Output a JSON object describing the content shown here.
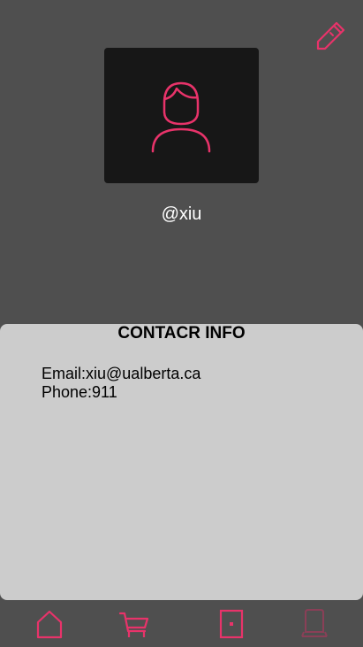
{
  "profile": {
    "username": "@xiu",
    "edit_icon": "pencil-icon",
    "avatar_icon": "user-icon"
  },
  "contact": {
    "title": "CONTACR INFO",
    "email_line": "Email:xiu@ualberta.ca",
    "phone_line": "Phone:911"
  },
  "nav": {
    "items": [
      {
        "icon": "home-icon",
        "active": false
      },
      {
        "icon": "cart-icon",
        "active": false
      },
      {
        "icon": "square-icon",
        "active": false
      },
      {
        "icon": "phone-icon",
        "active": true
      }
    ]
  },
  "colors": {
    "accent": "#e8336a",
    "accent_dim": "#8a3f57",
    "background": "#4f4f4f",
    "avatar_bg": "#171717",
    "card_bg": "#cccccc"
  }
}
